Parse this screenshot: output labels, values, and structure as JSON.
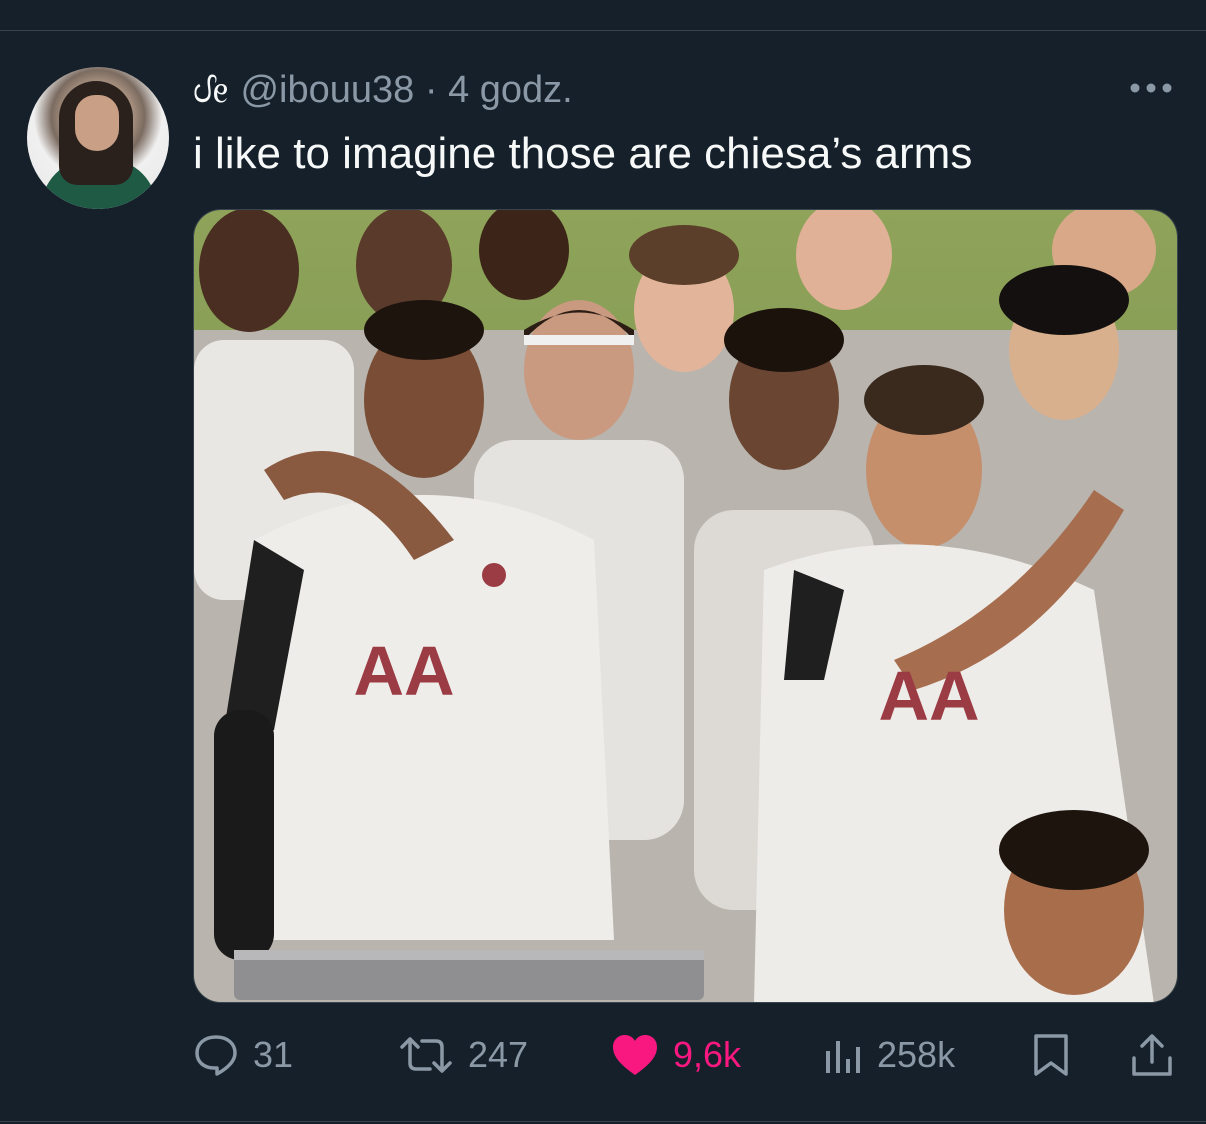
{
  "tweet": {
    "display_glyph": "ᦔᧉ",
    "handle": "@ibouu38",
    "separator": "·",
    "time": "4 godz.",
    "text": "i like to imagine those are chiesa’s arms",
    "avatar_icon": "user-avatar",
    "more_icon": "more-dots-icon"
  },
  "actions": {
    "replies": {
      "icon": "reply-icon",
      "count": "31"
    },
    "retweets": {
      "icon": "retweet-icon",
      "count": "247"
    },
    "likes": {
      "icon": "heart-filled-icon",
      "count": "9,6k",
      "color": "#f91880"
    },
    "views": {
      "icon": "views-bar-chart-icon",
      "count": "258k"
    },
    "bookmark": {
      "icon": "bookmark-icon"
    },
    "share": {
      "icon": "share-upload-icon"
    }
  },
  "colors": {
    "background": "#15202b",
    "text_primary": "#f7f9f9",
    "text_secondary": "#8b98a5",
    "divider": "#38444d",
    "like_active": "#f91880"
  },
  "media": {
    "jersey_text_left": "AA",
    "jersey_text_right": "AA"
  }
}
